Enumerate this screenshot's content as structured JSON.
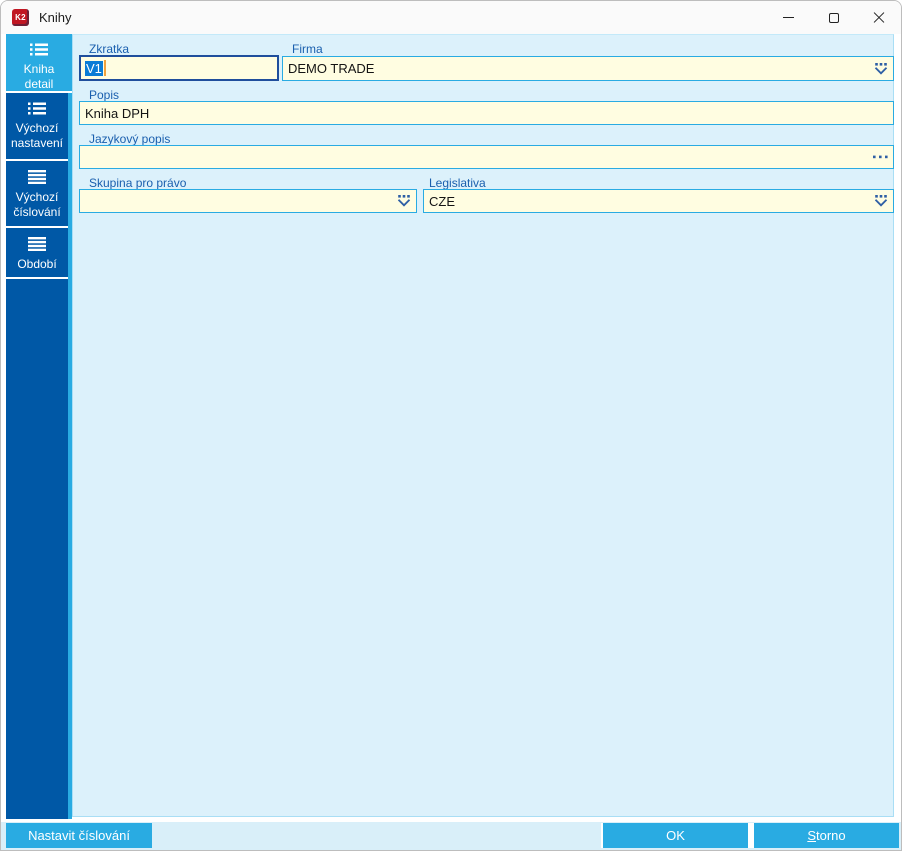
{
  "window": {
    "title": "Knihy",
    "app_icon_text": "K2",
    "controls": {
      "minimize": "minimize-icon",
      "maximize": "maximize-icon",
      "close": "close-icon"
    }
  },
  "sidebar": {
    "items": [
      {
        "label": "Kniha detail",
        "lines": [
          "Kniha",
          "detail"
        ],
        "icon": "dotted-list-icon",
        "active": true
      },
      {
        "label": "Výchozí nastavení",
        "lines": [
          "Výchozí",
          "nastavení"
        ],
        "icon": "dotted-list-icon",
        "active": false
      },
      {
        "label": "Výchozí číslování",
        "lines": [
          "Výchozí",
          "číslování"
        ],
        "icon": "menu-lines-icon",
        "active": false
      },
      {
        "label": "Období",
        "lines": [
          "Období"
        ],
        "icon": "menu-lines-icon",
        "active": false
      }
    ]
  },
  "form": {
    "zkratka": {
      "label": "Zkratka",
      "value": "V1",
      "state": "focused-text-selected"
    },
    "firma": {
      "label": "Firma",
      "value": "DEMO TRADE",
      "icon": "dropdown-icon"
    },
    "popis": {
      "label": "Popis",
      "value": "Kniha DPH"
    },
    "jazykovy_popis": {
      "label": "Jazykový popis",
      "value": "",
      "icon": "ellipsis-icon"
    },
    "skupina_pro_pravo": {
      "label": "Skupina pro právo",
      "value": "",
      "icon": "dropdown-icon"
    },
    "legislativa": {
      "label": "Legislativa",
      "value": "CZE",
      "icon": "dropdown-icon"
    }
  },
  "footer": {
    "nastavit_cislovani_label": "Nastavit číslování",
    "ok_label": "OK",
    "storno_accel": "S",
    "storno_rest": "torno"
  },
  "colors": {
    "accent_cyan": "#29ABE2",
    "sidebar_blue": "#0058A6",
    "content_bg": "#DCF1FB",
    "field_bg": "#FFFDE1",
    "focus_border": "#1F4E9C",
    "selection_bg": "#0A7CD6",
    "caret_orange": "#F0A23C",
    "label_blue": "#1A5FAE",
    "app_icon_red": "#C01622"
  }
}
